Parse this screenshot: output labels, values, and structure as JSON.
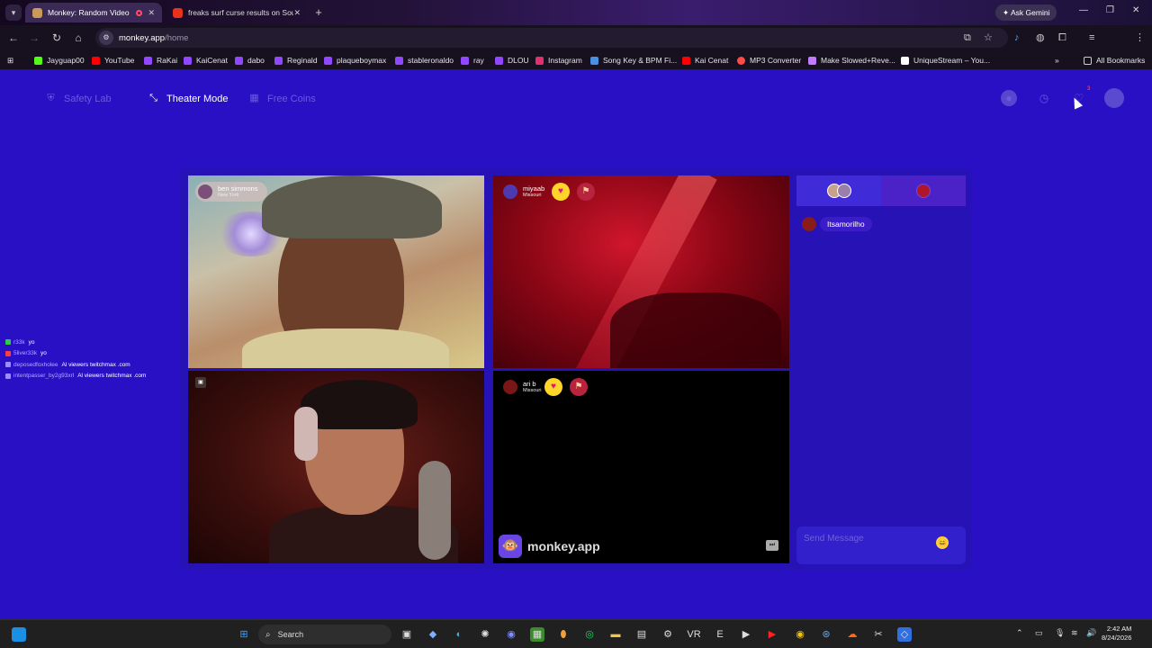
{
  "browser": {
    "tabs": [
      {
        "title": "Monkey: Random Video Ch",
        "active": true
      },
      {
        "title": "freaks surf curse results on Sou",
        "active": false
      }
    ],
    "ask_gemini": "Ask Gemini",
    "url_host": "monkey.app",
    "url_path": "/home",
    "bookmarks": [
      "Jayguap00",
      "YouTube",
      "RaKai",
      "KaiCenat",
      "dabo",
      "Reginald",
      "plaqueboymax",
      "stableronaldo",
      "ray",
      "DLOU",
      "Instagram",
      "Song Key & BPM Fi...",
      "Kai Cenat",
      "MP3 Converter",
      "Make Slowed+Reve...",
      "UniqueStream – You..."
    ],
    "all_bookmarks": "All Bookmarks"
  },
  "nav": {
    "safety_lab": "Safety Lab",
    "theater_mode": "Theater Mode",
    "free_coins": "Free Coins",
    "notification_count": "3"
  },
  "videos": [
    {
      "name": "ben simmons",
      "location": "New York"
    },
    {
      "name": "miyaab",
      "location": "Missouri"
    },
    {
      "name": "ari b",
      "location": "Missouri"
    }
  ],
  "brand": {
    "name": "monkey.app"
  },
  "chat": {
    "messages": [
      {
        "user": "Itsamorilho"
      }
    ],
    "placeholder": "Send Message"
  },
  "overlay_chat": [
    {
      "user": "r33k",
      "text": "yo",
      "color": "#2ecc40"
    },
    {
      "user": "5liver33k",
      "text": "yo",
      "color": "#ff3b3b"
    },
    {
      "user": "deposedfoxholee",
      "text": "Al viewers twitchmax .com",
      "color": "#9b8cff"
    },
    {
      "user": "intentpasser_by2g93xrl",
      "text": "Al viewers twitchmax .com",
      "color": "#9b8cff"
    }
  ],
  "taskbar": {
    "search": "Search",
    "time": "2:42 AM",
    "date": "8/24/2026"
  },
  "colors": {
    "page_bg": "#2a10c4",
    "accent": "#3f2cd8",
    "heart": "#ffd52a"
  }
}
